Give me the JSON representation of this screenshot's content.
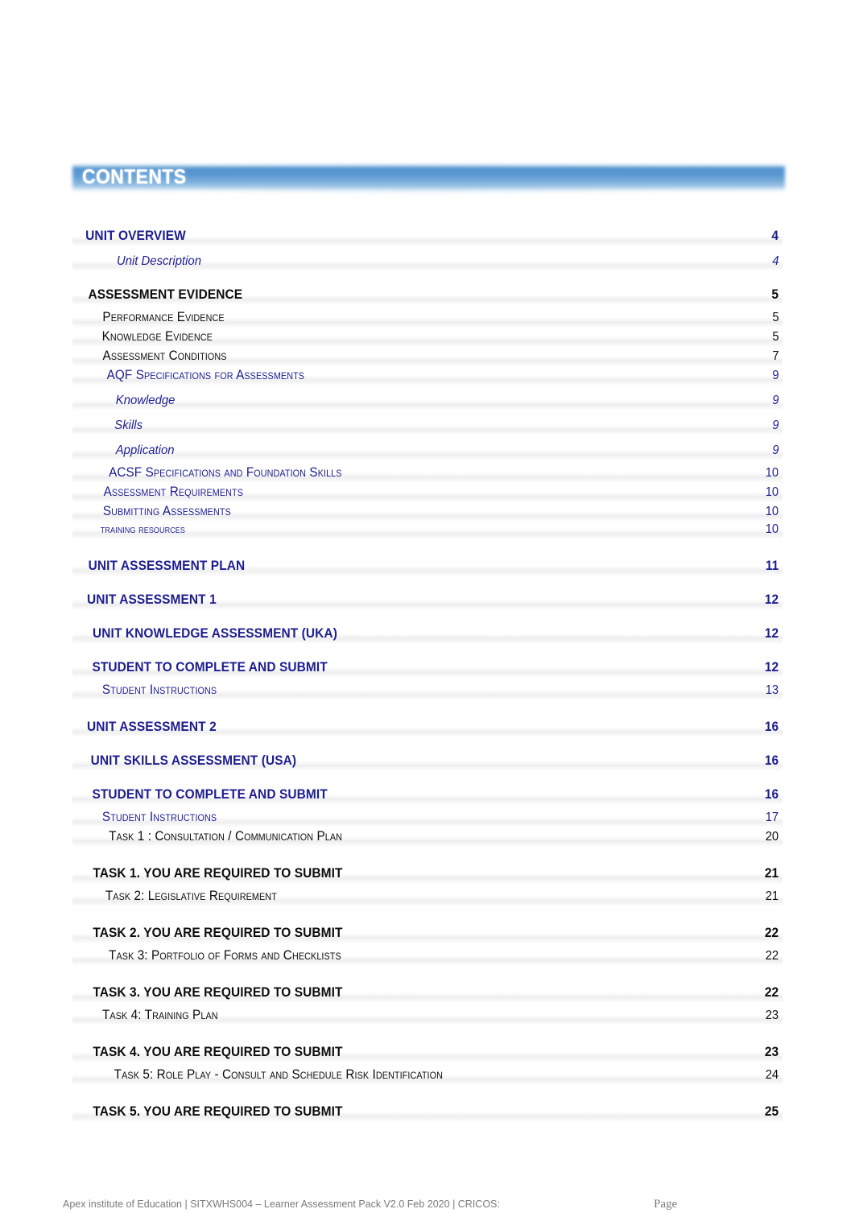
{
  "document": {
    "heading": "CONTENTS",
    "banner_color": "#5f9bd3",
    "navy": "#1d1d8f",
    "black": "#0c0c0c"
  },
  "toc": {
    "entries": [
      {
        "label": "UNIT OVERVIEW",
        "page": "4",
        "level": 1,
        "color": "navy"
      },
      {
        "label": "Unit Description",
        "page": "4",
        "level": 2,
        "color": "navy"
      },
      {
        "label": "ASSESSMENT EVIDENCE",
        "page": "5",
        "level": 1,
        "color": "black"
      },
      {
        "label": "Performance Evidence",
        "page": "5",
        "level": 3,
        "color": "black"
      },
      {
        "label": "Knowledge Evidence",
        "page": "5",
        "level": 3,
        "color": "black"
      },
      {
        "label": "Assessment Conditions",
        "page": "7",
        "level": 3,
        "color": "black"
      },
      {
        "label": "AQF Specifications for Assessments",
        "page": "9",
        "level": 3,
        "color": "navy"
      },
      {
        "label": "Knowledge",
        "page": "9",
        "level": 2,
        "color": "navy"
      },
      {
        "label": "Skills",
        "page": "9",
        "level": 2,
        "color": "navy"
      },
      {
        "label": "Application",
        "page": "9",
        "level": 2,
        "color": "navy"
      },
      {
        "label": "ACSF Specifications and Foundation Skills",
        "page": "10",
        "level": 3,
        "color": "navy"
      },
      {
        "label": "Assessment Requirements",
        "page": "10",
        "level": 3,
        "color": "navy"
      },
      {
        "label": "Submitting Assessments",
        "page": "10",
        "level": 3,
        "color": "navy"
      },
      {
        "label": "TRAINING RESOURCES",
        "page": "10",
        "level": 3,
        "color": "navy"
      },
      {
        "label": "UNIT ASSESSMENT PLAN",
        "page": "11",
        "level": 1,
        "color": "navy"
      },
      {
        "label": "UNIT ASSESSMENT 1",
        "page": "12",
        "level": 1,
        "color": "navy"
      },
      {
        "label": "UNIT KNOWLEDGE ASSESSMENT (UKA)",
        "page": "12",
        "level": 1,
        "color": "navy"
      },
      {
        "label": "STUDENT TO COMPLETE AND SUBMIT",
        "page": "12",
        "level": 1,
        "color": "navy"
      },
      {
        "label": "Student Instructions",
        "page": "13",
        "level": 3,
        "color": "navy"
      },
      {
        "label": "UNIT ASSESSMENT 2",
        "page": "16",
        "level": 1,
        "color": "navy"
      },
      {
        "label": "UNIT SKILLS ASSESSMENT (USA)",
        "page": "16",
        "level": 1,
        "color": "navy"
      },
      {
        "label": "STUDENT TO COMPLETE AND SUBMIT",
        "page": "16",
        "level": 1,
        "color": "navy"
      },
      {
        "label": "Student Instructions",
        "page": "17",
        "level": 3,
        "color": "navy"
      },
      {
        "label": "Task 1 : Consultation / Communication Plan",
        "page": "20",
        "level": 3,
        "color": "black"
      },
      {
        "label": "TASK 1. YOU ARE REQUIRED TO SUBMIT",
        "page": "21",
        "level": 1,
        "color": "black"
      },
      {
        "label": "Task 2: Legislative Requirement",
        "page": "21",
        "level": 3,
        "color": "black"
      },
      {
        "label": "TASK 2. YOU ARE REQUIRED TO SUBMIT",
        "page": "22",
        "level": 1,
        "color": "black"
      },
      {
        "label": "Task 3: Portfolio of Forms and Checklists",
        "page": "22",
        "level": 3,
        "color": "black"
      },
      {
        "label": "TASK 3. YOU ARE REQUIRED TO SUBMIT",
        "page": "22",
        "level": 1,
        "color": "black"
      },
      {
        "label": "Task 4: Training Plan",
        "page": "23",
        "level": 3,
        "color": "black"
      },
      {
        "label": "TASK 4. YOU ARE REQUIRED TO SUBMIT",
        "page": "23",
        "level": 1,
        "color": "black"
      },
      {
        "label": "Task 5: Role Play - Consult and Schedule Risk Identification",
        "page": "24",
        "level": 3,
        "color": "black"
      },
      {
        "label": "TASK 5. YOU ARE REQUIRED TO SUBMIT",
        "page": "25",
        "level": 1,
        "color": "black"
      }
    ]
  },
  "footer": {
    "left": "Apex institute of Education | SITXWHS004 – Learner Assessment Pack V2.0  Feb 2020 | CRICOS:",
    "right": "Page"
  }
}
